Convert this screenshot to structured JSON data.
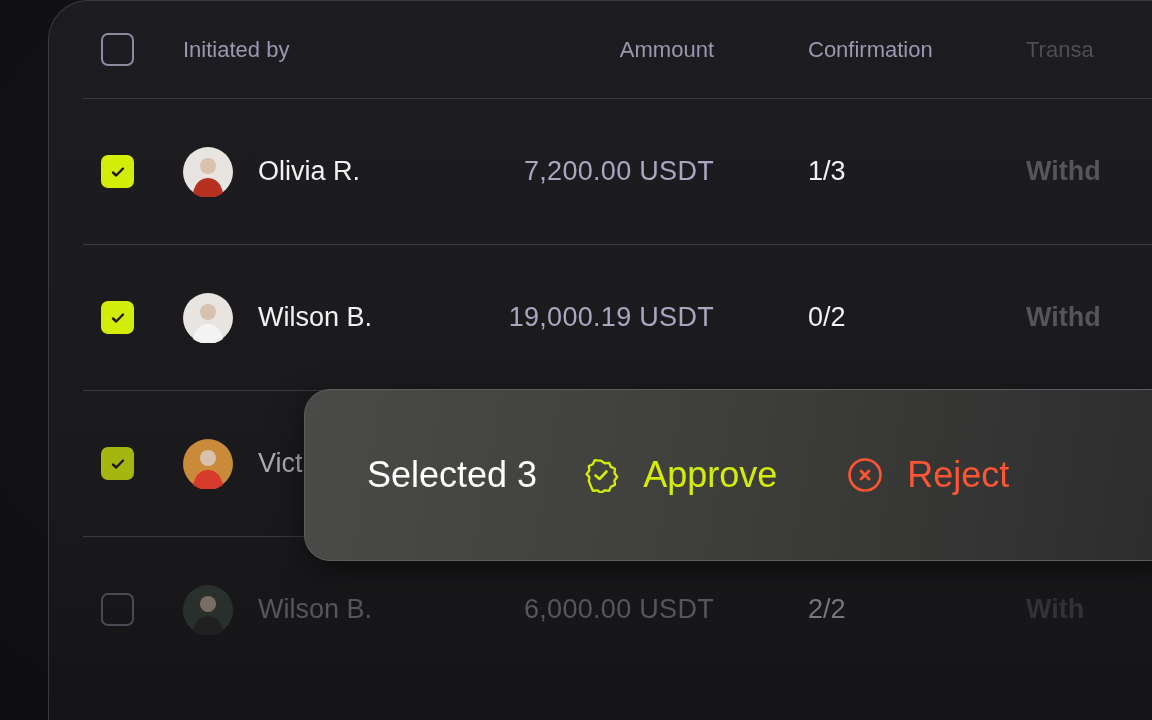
{
  "table": {
    "columns": [
      {
        "label": "Initiated by"
      },
      {
        "label": "Ammount"
      },
      {
        "label": "Confirmation"
      },
      {
        "label": "Transa"
      }
    ],
    "header_checked": false,
    "rows": [
      {
        "checked": true,
        "name": "Olivia R.",
        "amount": "7,200.00 USDT",
        "confirmation": "1/3",
        "transaction": "Withd"
      },
      {
        "checked": true,
        "name": "Wilson B.",
        "amount": "19,000.19 USDT",
        "confirmation": "0/2",
        "transaction": "Withd"
      },
      {
        "checked": true,
        "name": "Vict"
      },
      {
        "checked": false,
        "name": "Wilson B.",
        "amount": "6,000.00 USDT",
        "confirmation": "2/2",
        "transaction": "With"
      }
    ]
  },
  "selection_bar": {
    "label": "Selected 3",
    "actions": [
      {
        "kind": "approve",
        "label": "Approve"
      },
      {
        "kind": "reject",
        "label": "Reject"
      }
    ]
  }
}
